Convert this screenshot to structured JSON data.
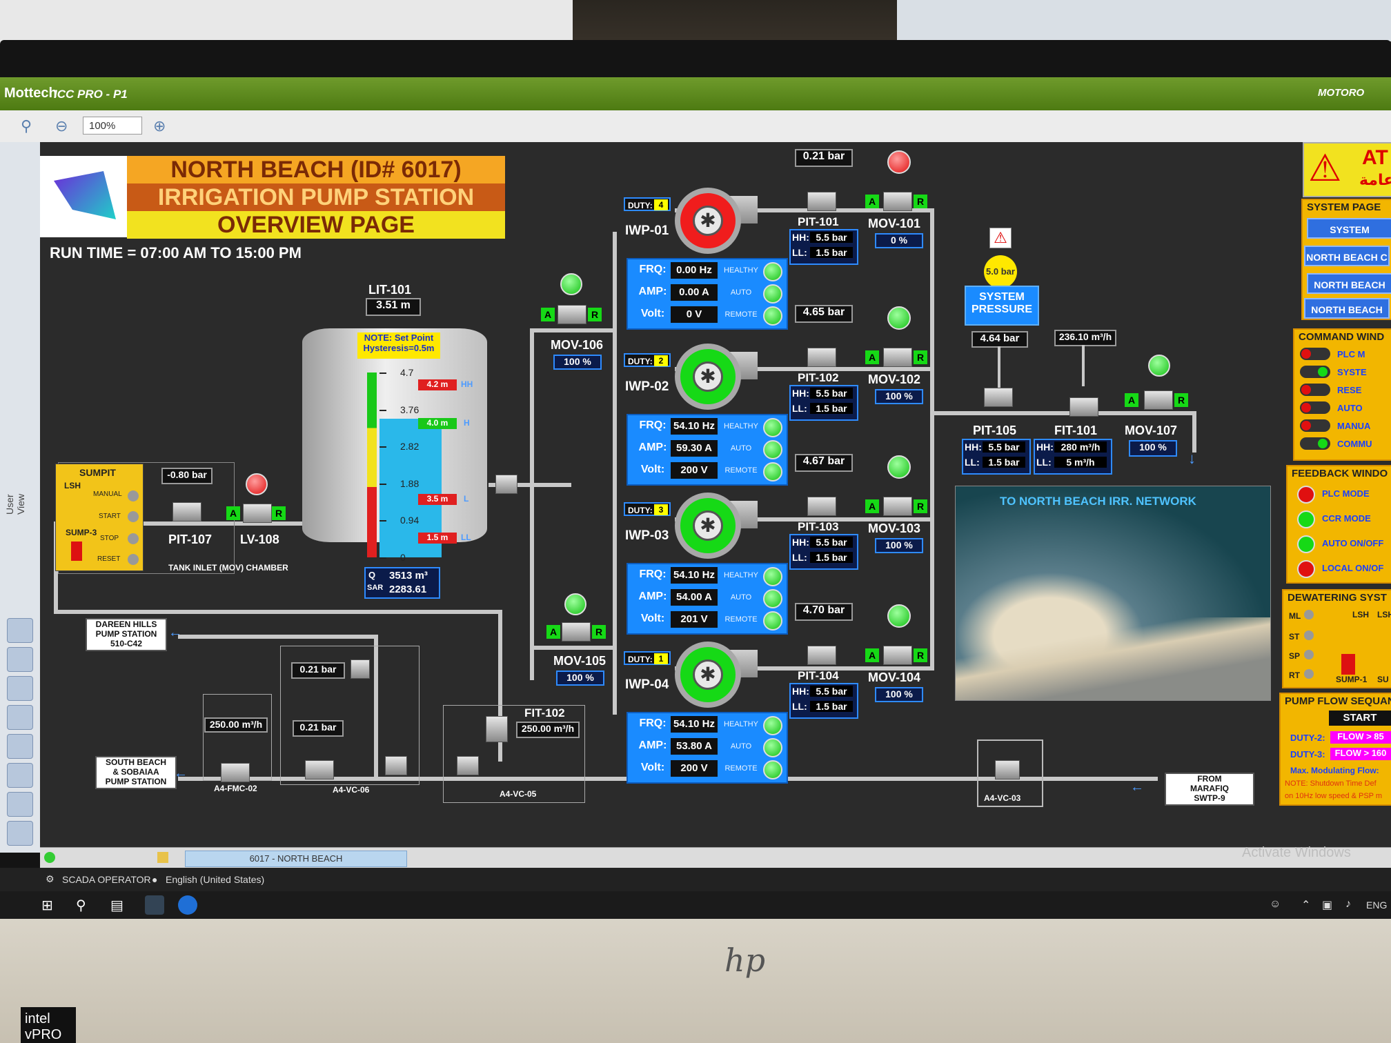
{
  "app": {
    "vendor_logo": "Mottech",
    "window_title": "ICC PRO - P1",
    "brand": "MOTORO",
    "zoom": "100%",
    "side_label": "User View"
  },
  "header": {
    "line1": "NORTH BEACH (ID# 6017)",
    "line2": "IRRIGATION PUMP STATION",
    "line3": "OVERVIEW PAGE",
    "run_time": "RUN TIME = 07:00 AM TO 15:00 PM"
  },
  "tank": {
    "tag": "LIT-101",
    "level": "3.51 m",
    "note_line1": "NOTE: Set Point",
    "note_line2": "Hysteresis=0.5m",
    "scale": [
      "4.7",
      "3.76",
      "2.82",
      "1.88",
      "0.94",
      "0"
    ],
    "hh_value": "4.2 m",
    "hh": "HH",
    "h_value": "4.0 m",
    "h": "H",
    "l_value": "3.5 m",
    "l": "L",
    "ll_value": "1.5 m",
    "ll": "LL",
    "fill_fraction": 0.75,
    "q_label": "Q",
    "q_value": "3513 m³",
    "sar_label": "SAR",
    "sar_value": "2283.61"
  },
  "sump": {
    "title": "SUMPIT",
    "lsh": "LSH",
    "sump_label": "SUMP-3",
    "buttons": [
      "MANUAL",
      "START",
      "STOP",
      "RESET"
    ],
    "pit107_value": "-0.80 bar",
    "pit107": "PIT-107",
    "lv108": "LV-108",
    "chamber": "TANK INLET (MOV) CHAMBER"
  },
  "mov106": {
    "tag": "MOV-106",
    "pct": "100 %"
  },
  "mov105": {
    "tag": "MOV-105",
    "pct": "100 %"
  },
  "pumps": [
    {
      "name": "IWP-01",
      "duty_label": "DUTY:",
      "duty": "4",
      "frq": "0.00 Hz",
      "amp": "0.00 A",
      "volt": "0 V",
      "pit": "PIT-101",
      "pit_value": "0.21 bar",
      "hh": "5.5 bar",
      "ll": "1.5 bar",
      "mov": "MOV-101",
      "mov_pct": "0 %"
    },
    {
      "name": "IWP-02",
      "duty_label": "DUTY:",
      "duty": "2",
      "frq": "54.10 Hz",
      "amp": "59.30 A",
      "volt": "200 V",
      "pit": "PIT-102",
      "pit_value": "4.65 bar",
      "hh": "5.5 bar",
      "ll": "1.5 bar",
      "mov": "MOV-102",
      "mov_pct": "100 %"
    },
    {
      "name": "IWP-03",
      "duty_label": "DUTY:",
      "duty": "3",
      "frq": "54.10 Hz",
      "amp": "54.00 A",
      "volt": "201 V",
      "pit": "PIT-103",
      "pit_value": "4.67 bar",
      "hh": "5.5 bar",
      "ll": "1.5 bar",
      "mov": "MOV-103",
      "mov_pct": "100 %"
    },
    {
      "name": "IWP-04",
      "duty_label": "DUTY:",
      "duty": "1",
      "frq": "54.10 Hz",
      "amp": "53.80 A",
      "volt": "200 V",
      "pit": "PIT-104",
      "pit_value": "4.70 bar",
      "hh": "5.5 bar",
      "ll": "1.5 bar",
      "mov": "MOV-104",
      "mov_pct": "100 %"
    }
  ],
  "panel_labels": {
    "frq": "FRQ:",
    "amp": "AMP:",
    "volt": "Volt:",
    "healthy": "HEALTHY",
    "auto": "AUTO",
    "remote": "REMOTE",
    "hh": "HH:",
    "ll": "LL:",
    "a": "A",
    "r": "R"
  },
  "system_pressure": {
    "value": "5.0 bar",
    "line1": "SYSTEM",
    "line2": "PRESSURE"
  },
  "pit105": {
    "tag": "PIT-105",
    "value": "4.64 bar",
    "hh": "5.5 bar",
    "ll": "1.5 bar"
  },
  "fit101": {
    "tag": "FIT-101",
    "value": "236.10 m³/h",
    "hh": "280 m³/h",
    "ll": "5 m³/h"
  },
  "mov107": {
    "tag": "MOV-107",
    "pct": "100 %"
  },
  "network_map_title": "TO NORTH BEACH IRR. NETWORK",
  "lower": {
    "dareen": "DAREEN HILLS\nPUMP STATION\n510-C42",
    "south_beach": "SOUTH BEACH\n& SOBAIAA\nPUMP STATION",
    "from_marafiq": "FROM\nMARAFIQ\nSWTP-9",
    "fmc02_value": "250.00 m³/h",
    "fmc02": "A4-FMC-02",
    "vc06_top": "0.21 bar",
    "vc06_value": "0.21 bar",
    "vc06": "A4-VC-06",
    "fit102": "FIT-102",
    "fit102_value": "250.00 m³/h",
    "vc05": "A4-VC-05",
    "vc03": "A4-VC-03"
  },
  "right": {
    "alarm": "AT",
    "alarm_ar": "عامة",
    "system_pages_title": "SYSTEM PAGE",
    "system_pages": [
      "SYSTEM",
      "NORTH BEACH C",
      "NORTH BEACH",
      "NORTH BEACH"
    ],
    "command_title": "COMMAND WIND",
    "commands": [
      "PLC M",
      "SYSTE",
      "RESE",
      "AUTO",
      "MANUA",
      "COMMU"
    ],
    "feedback_title": "FEEDBACK WINDO",
    "feedback": [
      "PLC MODE",
      "CCR MODE",
      "AUTO ON/OFF",
      "LOCAL ON/OF"
    ],
    "dewatering_title": "DEWATERING SYST",
    "dewater_labels": [
      "ML",
      "ST",
      "SP",
      "RT"
    ],
    "dewater_lsh": "LSH",
    "dewater_lsh2": "LSH",
    "sump1": "SUMP-1",
    "sump_su": "SU",
    "seq_title": "PUMP FLOW SEQUAN",
    "start": "START",
    "duty2": "DUTY-2:",
    "duty2_val": "FLOW > 85",
    "duty3": "DUTY-3:",
    "duty3_val": "FLOW > 160",
    "maxmod": "Max. Modulating Flow:",
    "note1": "NOTE: Shutdown Time Def",
    "note2": "on 10Hz low speed & PSP m"
  },
  "status": {
    "tab": "6017 - NORTH BEACH",
    "operator": "SCADA OPERATOR",
    "language": "English (United States)",
    "activate": "Activate Windows",
    "tray_lang": "ENG"
  }
}
